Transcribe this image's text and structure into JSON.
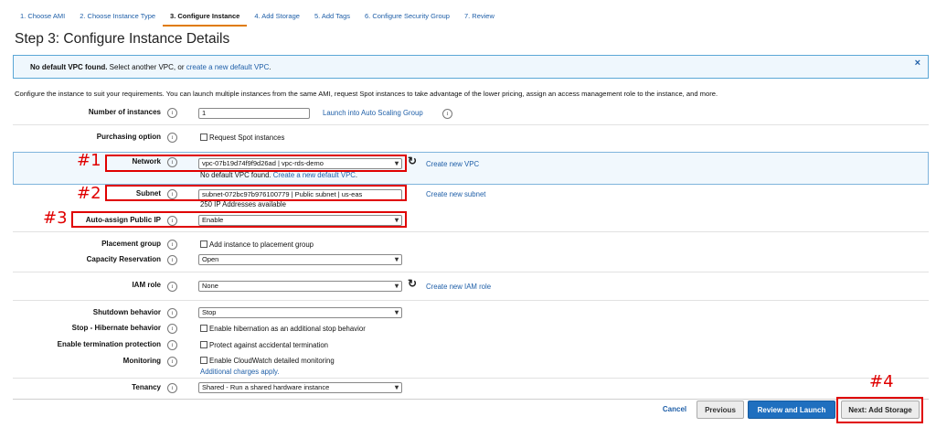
{
  "tabs": [
    "1. Choose AMI",
    "2. Choose Instance Type",
    "3. Configure Instance",
    "4. Add Storage",
    "5. Add Tags",
    "6. Configure Security Group",
    "7. Review"
  ],
  "active_tab": 2,
  "page_title": "Step 3: Configure Instance Details",
  "alert": {
    "bold": "No default VPC found.",
    "text": " Select another VPC, or ",
    "link": "create a new default VPC",
    "tail": ".",
    "close": "×"
  },
  "description": "Configure the instance to suit your requirements. You can launch multiple instances from the same AMI, request Spot instances to take advantage of the lower pricing, assign an access management role to the instance, and more.",
  "info_glyph": "i",
  "fields": {
    "instances": {
      "label": "Number of instances",
      "value": "1",
      "link": "Launch into Auto Scaling Group"
    },
    "purchasing": {
      "label": "Purchasing option",
      "checkbox": "Request Spot instances"
    },
    "network": {
      "label": "Network",
      "value": "vpc-07b19d74f9f9d26ad | vpc-rds-demo",
      "link": "Create new VPC",
      "note": "No default VPC found.",
      "note_link": "Create a new default VPC",
      "note_tail": "."
    },
    "subnet": {
      "label": "Subnet",
      "value": "subnet-072bc97b976100779 | Public subnet | us-eas",
      "link": "Create new subnet",
      "note": "250 IP Addresses available"
    },
    "public_ip": {
      "label": "Auto-assign Public IP",
      "value": "Enable"
    },
    "placement": {
      "label": "Placement group",
      "checkbox": "Add instance to placement group"
    },
    "capacity": {
      "label": "Capacity Reservation",
      "value": "Open"
    },
    "iam": {
      "label": "IAM role",
      "value": "None",
      "link": "Create new IAM role"
    },
    "shutdown": {
      "label": "Shutdown behavior",
      "value": "Stop"
    },
    "hibernate": {
      "label": "Stop - Hibernate behavior",
      "checkbox": "Enable hibernation as an additional stop behavior"
    },
    "termination": {
      "label": "Enable termination protection",
      "checkbox": "Protect against accidental termination"
    },
    "monitoring": {
      "label": "Monitoring",
      "checkbox": "Enable CloudWatch detailed monitoring",
      "note_link": "Additional charges apply."
    },
    "tenancy": {
      "label": "Tenancy",
      "value": "Shared - Run a shared hardware instance"
    }
  },
  "annotations": [
    "#1",
    "#2",
    "#3",
    "#4"
  ],
  "buttons": {
    "cancel": "Cancel",
    "previous": "Previous",
    "review": "Review and Launch",
    "next": "Next: Add Storage"
  },
  "icons": {
    "refresh": "refresh-icon",
    "dropdown": "chevron-down-icon",
    "info": "info-icon",
    "close": "close-icon"
  },
  "colors": {
    "link": "#1f5fa8",
    "annotation": "#e00000",
    "primary": "#1f6fbf",
    "tab_active": "#e07b00"
  }
}
